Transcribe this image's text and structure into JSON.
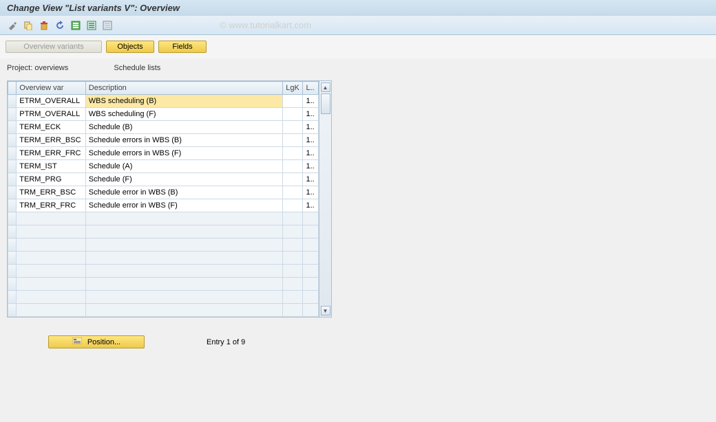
{
  "title": "Change View \"List variants               V\": Overview",
  "watermark": "© www.tutorialkart.com",
  "nav_buttons": {
    "overview_variants": "Overview variants",
    "objects": "Objects",
    "fields": "Fields"
  },
  "project_line": {
    "label": "Project: overviews",
    "value": "Schedule lists"
  },
  "columns": {
    "overview_var": "Overview var",
    "description": "Description",
    "lgk": "LgK",
    "l": "L.."
  },
  "rows": [
    {
      "var": "ETRM_OVERALL",
      "desc": "WBS scheduling (B)",
      "lgk": "",
      "l": "1..",
      "selected": true
    },
    {
      "var": "PTRM_OVERALL",
      "desc": "WBS scheduling (F)",
      "lgk": "",
      "l": "1.."
    },
    {
      "var": "TERM_ECK",
      "desc": "Schedule (B)",
      "lgk": "",
      "l": "1.."
    },
    {
      "var": "TERM_ERR_BSC",
      "desc": "Schedule errors in WBS (B)",
      "lgk": "",
      "l": "1.."
    },
    {
      "var": "TERM_ERR_FRC",
      "desc": "Schedule errors in WBS (F)",
      "lgk": "",
      "l": "1.."
    },
    {
      "var": "TERM_IST",
      "desc": "Schedule (A)",
      "lgk": "",
      "l": "1.."
    },
    {
      "var": "TERM_PRG",
      "desc": "Schedule (F)",
      "lgk": "",
      "l": "1.."
    },
    {
      "var": "TRM_ERR_BSC",
      "desc": "Schedule error in WBS (B)",
      "lgk": "",
      "l": "1.."
    },
    {
      "var": "TRM_ERR_FRC",
      "desc": "Schedule error in WBS (F)",
      "lgk": "",
      "l": "1.."
    }
  ],
  "empty_rows": 8,
  "footer": {
    "position_btn": "Position...",
    "entry_text": "Entry 1 of 9"
  }
}
